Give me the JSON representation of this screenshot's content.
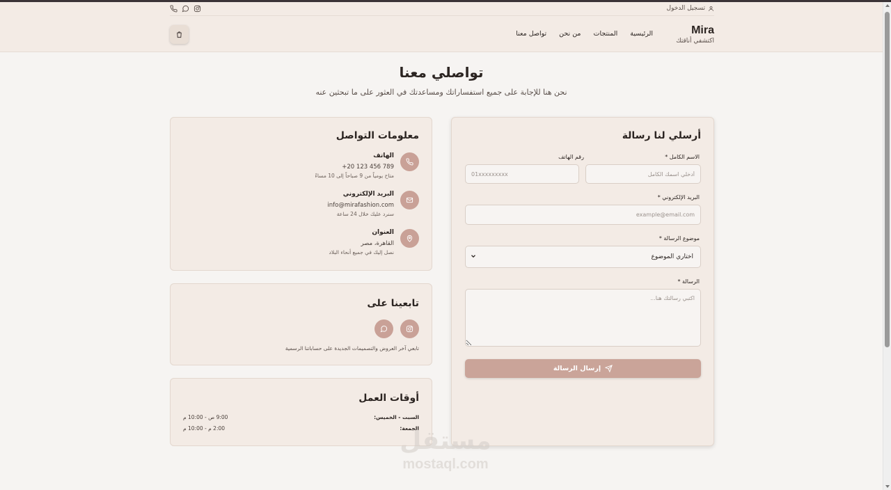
{
  "header": {
    "login_label": "تسجيل الدخول",
    "brand_name": "Mira",
    "brand_tagline": "اكتشفي أناقتك",
    "nav": [
      "الرئيسية",
      "المنتجات",
      "من نحن",
      "تواصل معنا"
    ],
    "util_icons": [
      "phone-icon",
      "chat-icon",
      "instagram-icon"
    ],
    "cart_icon": "shopping-bag-icon"
  },
  "hero": {
    "title": "تواصلي معنا",
    "subtitle": "نحن هنا للإجابة على جميع استفساراتك ومساعدتك في العثور على ما تبحثين عنه"
  },
  "form": {
    "title": "أرسلي لنا رسالة",
    "name_label": "الاسم الكامل *",
    "name_placeholder": "أدخلي اسمك الكامل",
    "phone_label": "رقم الهاتف",
    "phone_placeholder": "01xxxxxxxxx",
    "email_label": "البريد الإلكتروني *",
    "email_placeholder": "example@email.com",
    "subject_label": "موضوع الرسالة *",
    "subject_value": "اختاري الموضوع",
    "message_label": "الرسالة *",
    "message_placeholder": "اكتبي رسالتك هنا...",
    "submit_label": "إرسال الرسالة"
  },
  "contact_info": {
    "title": "معلومات التواصل",
    "items": [
      {
        "icon": "phone-icon",
        "title": "الهاتف",
        "value": "+20 123 456 789",
        "note": "متاح يومياً من 9 صباحاً إلى 10 مساءً"
      },
      {
        "icon": "mail-icon",
        "title": "البريد الإلكتروني",
        "value": "info@mirafashion.com",
        "note": "سنرد عليك خلال 24 ساعة"
      },
      {
        "icon": "location-icon",
        "title": "العنوان",
        "value": "القاهرة، مصر",
        "note": "نصل إليك في جميع أنحاء البلاد"
      }
    ]
  },
  "follow": {
    "title": "تابعينا على",
    "icons": [
      "instagram-icon",
      "chat-icon"
    ],
    "text": "تابعي آخر العروض والتصميمات الجديدة على حساباتنا الرسمية"
  },
  "hours": {
    "title": "أوقات العمل",
    "rows": [
      {
        "day": "السبت - الخميس:",
        "time": "9:00 ص - 10:00 م"
      },
      {
        "day": "الجمعة:",
        "time": "2:00 م - 10:00 م"
      }
    ]
  },
  "watermark": {
    "arabic": "مستقل",
    "latin": "mostaql.com"
  },
  "colors": {
    "accent": "#c9a197",
    "button": "#caa499",
    "header_bg": "#f3ebe5",
    "page_bg": "#f6f4f2"
  }
}
